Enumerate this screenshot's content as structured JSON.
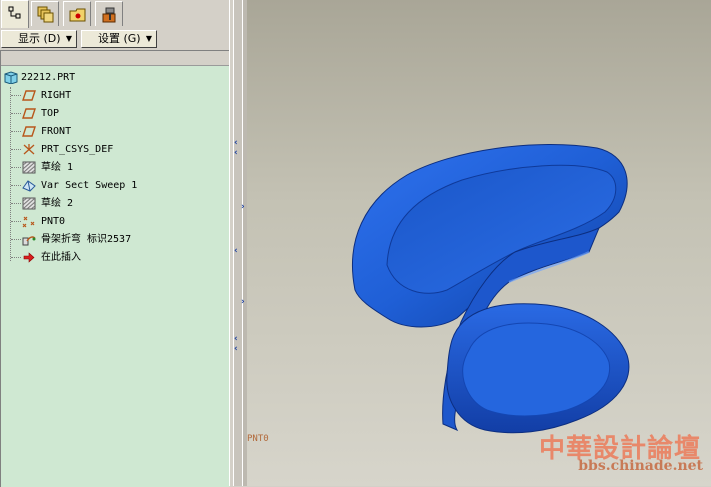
{
  "tabs": [
    {
      "name": "model-tree-icon"
    },
    {
      "name": "layers-icon"
    },
    {
      "name": "folder-icon"
    },
    {
      "name": "tools-icon"
    }
  ],
  "toolbar": {
    "show_label": "显示 (D)",
    "settings_label": "设置 (G)"
  },
  "tree": {
    "root": "22212.PRT",
    "items": [
      {
        "label": "RIGHT",
        "icon": "datum-plane-icon"
      },
      {
        "label": "TOP",
        "icon": "datum-plane-icon"
      },
      {
        "label": "FRONT",
        "icon": "datum-plane-icon"
      },
      {
        "label": "PRT_CSYS_DEF",
        "icon": "coordinate-system-icon"
      },
      {
        "label": "草绘 1",
        "icon": "sketch-icon"
      },
      {
        "label": "Var Sect Sweep 1",
        "icon": "sweep-icon"
      },
      {
        "label": "草绘 2",
        "icon": "sketch-icon"
      },
      {
        "label": "PNT0",
        "icon": "datum-point-icon"
      },
      {
        "label": "骨架折弯 标识2537",
        "icon": "spinal-bend-icon"
      },
      {
        "label": "在此插入",
        "icon": "insert-here-arrow-icon"
      }
    ]
  },
  "viewport": {
    "point_label": "PNT0",
    "model_color": "#1f5fd6"
  },
  "watermark": {
    "title": "中華設計論壇",
    "url": "bbs.chinade.net"
  }
}
